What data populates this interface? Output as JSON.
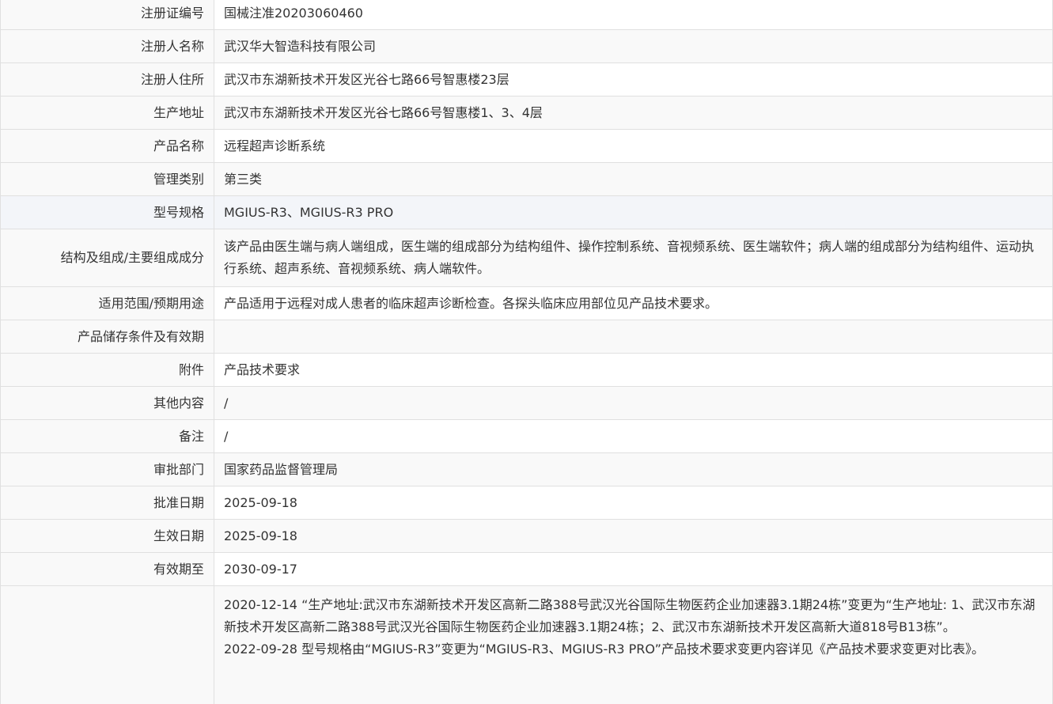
{
  "rows": [
    {
      "label": "注册证编号",
      "value": "国械注准20203060460"
    },
    {
      "label": "注册人名称",
      "value": "武汉华大智造科技有限公司"
    },
    {
      "label": "注册人住所",
      "value": "武汉市东湖新技术开发区光谷七路66号智惠楼23层"
    },
    {
      "label": "生产地址",
      "value": "武汉市东湖新技术开发区光谷七路66号智惠楼1、3、4层"
    },
    {
      "label": "产品名称",
      "value": "远程超声诊断系统"
    },
    {
      "label": "管理类别",
      "value": "第三类"
    },
    {
      "label": "型号规格",
      "value": "MGIUS-R3、MGIUS-R3 PRO"
    },
    {
      "label": "结构及组成/主要组成成分",
      "value": "该产品由医生端与病人端组成，医生端的组成部分为结构组件、操作控制系统、音视频系统、医生端软件；病人端的组成部分为结构组件、运动执行系统、超声系统、音视频系统、病人端软件。"
    },
    {
      "label": "适用范围/预期用途",
      "value": "产品适用于远程对成人患者的临床超声诊断检查。各探头临床应用部位见产品技术要求。"
    },
    {
      "label": "产品储存条件及有效期",
      "value": ""
    },
    {
      "label": "附件",
      "value": "产品技术要求"
    },
    {
      "label": "其他内容",
      "value": "/"
    },
    {
      "label": "备注",
      "value": "/"
    },
    {
      "label": "审批部门",
      "value": "国家药品监督管理局"
    },
    {
      "label": "批准日期",
      "value": "2025-09-18"
    },
    {
      "label": "生效日期",
      "value": "2025-09-18"
    },
    {
      "label": "有效期至",
      "value": "2030-09-17"
    }
  ],
  "change_history": {
    "label": "",
    "entries": [
      "2020-12-14 “生产地址:武汉市东湖新技术开发区高新二路388号武汉光谷国际生物医药企业加速器3.1期24栋”变更为“生产地址: 1、武汉市东湖新技术开发区高新二路388号武汉光谷国际生物医药企业加速器3.1期24栋；2、武汉市东湖新技术开发区高新大道818号B13栋”。",
      "2022-09-28 型号规格由“MGIUS-R3”变更为“MGIUS-R3、MGIUS-R3 PRO”产品技术要求变更内容详见《产品技术要求变更对比表》。"
    ]
  }
}
